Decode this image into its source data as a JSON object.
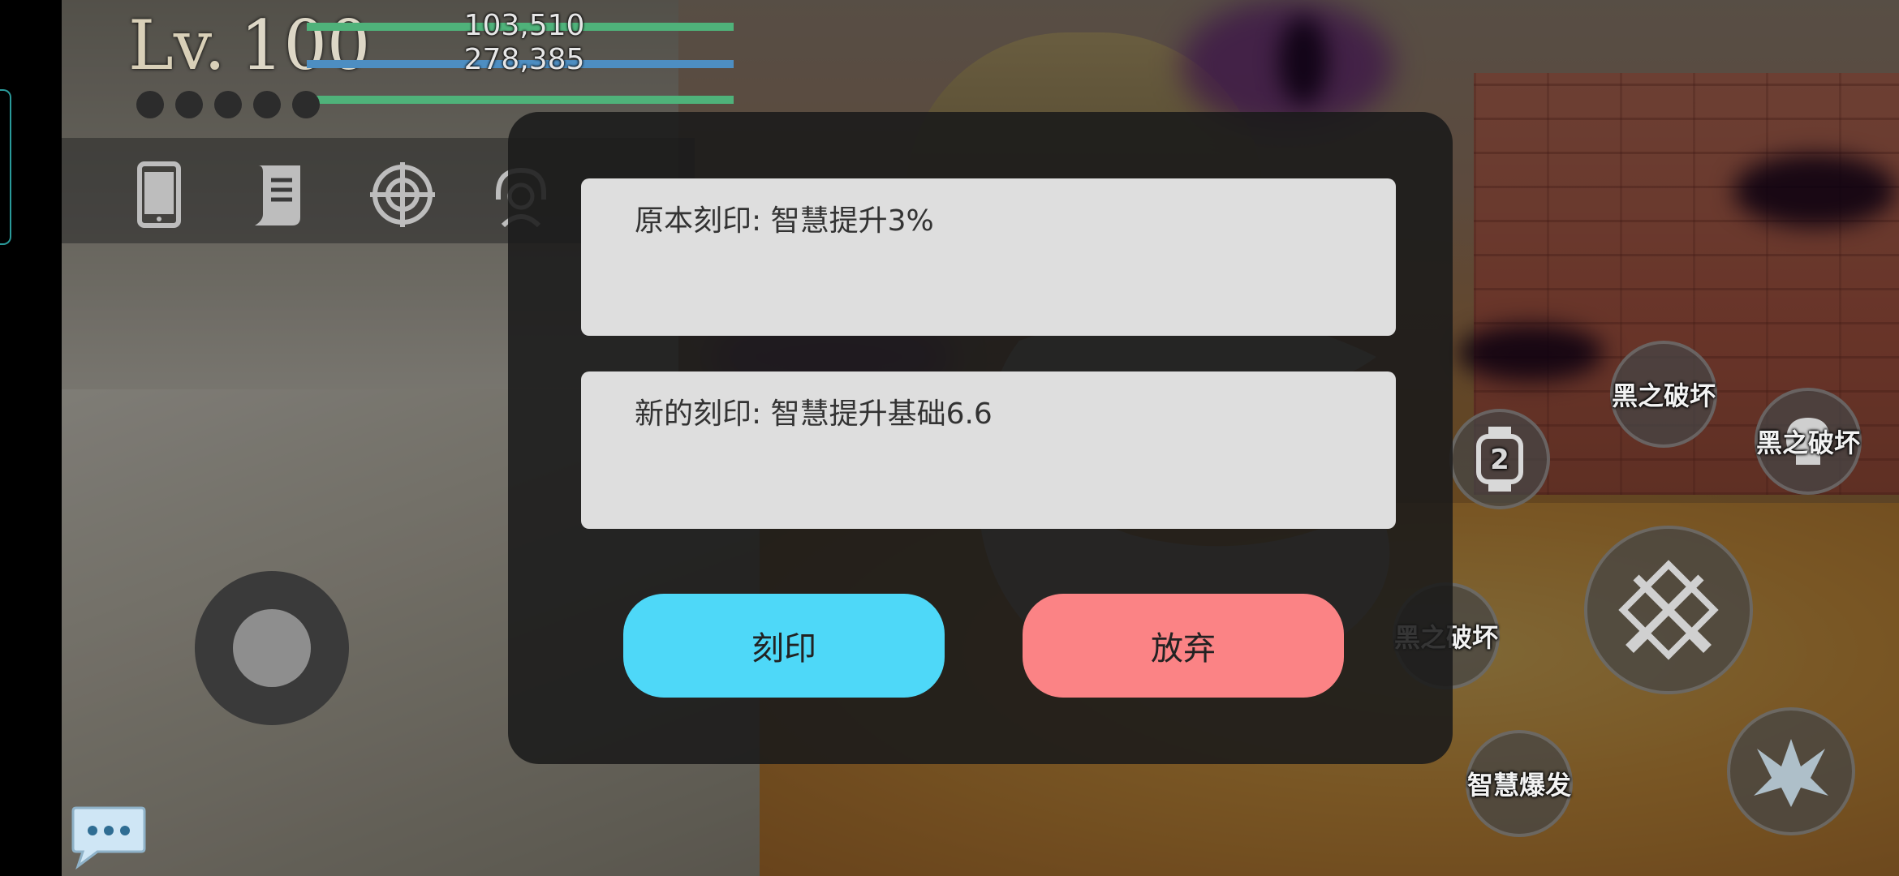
{
  "hud": {
    "level_prefix": "Lv.",
    "level_value": "100",
    "hp_value": "103,510",
    "mp_value": "278,385",
    "colors": {
      "hp_bar": "#4fb27a",
      "mp_bar": "#4d8ec2",
      "xp_bar": "#4fb27a"
    },
    "icons": [
      "phone-icon",
      "scroll-icon",
      "target-icon",
      "headset-icon"
    ]
  },
  "dialog": {
    "original_engraving": "原本刻印: 智慧提升3%",
    "new_engraving": "新的刻印: 智慧提升基础6.6",
    "engrave_label": "刻印",
    "abandon_label": "放弃",
    "colors": {
      "engrave": "#4ed8f8",
      "abandon": "#fb8385"
    }
  },
  "skills": {
    "dark_break_1": "黑之破坏",
    "dark_break_2": "黑之破坏",
    "dark_break_3": "黑之破坏",
    "wisdom_burst": "智慧爆发",
    "watch_badge": "2",
    "icons": [
      "watch-icon",
      "skull-icon",
      "crossed-swords-icon",
      "winged-emblem-icon"
    ]
  },
  "chat": {
    "icon": "chat-bubble-icon"
  }
}
